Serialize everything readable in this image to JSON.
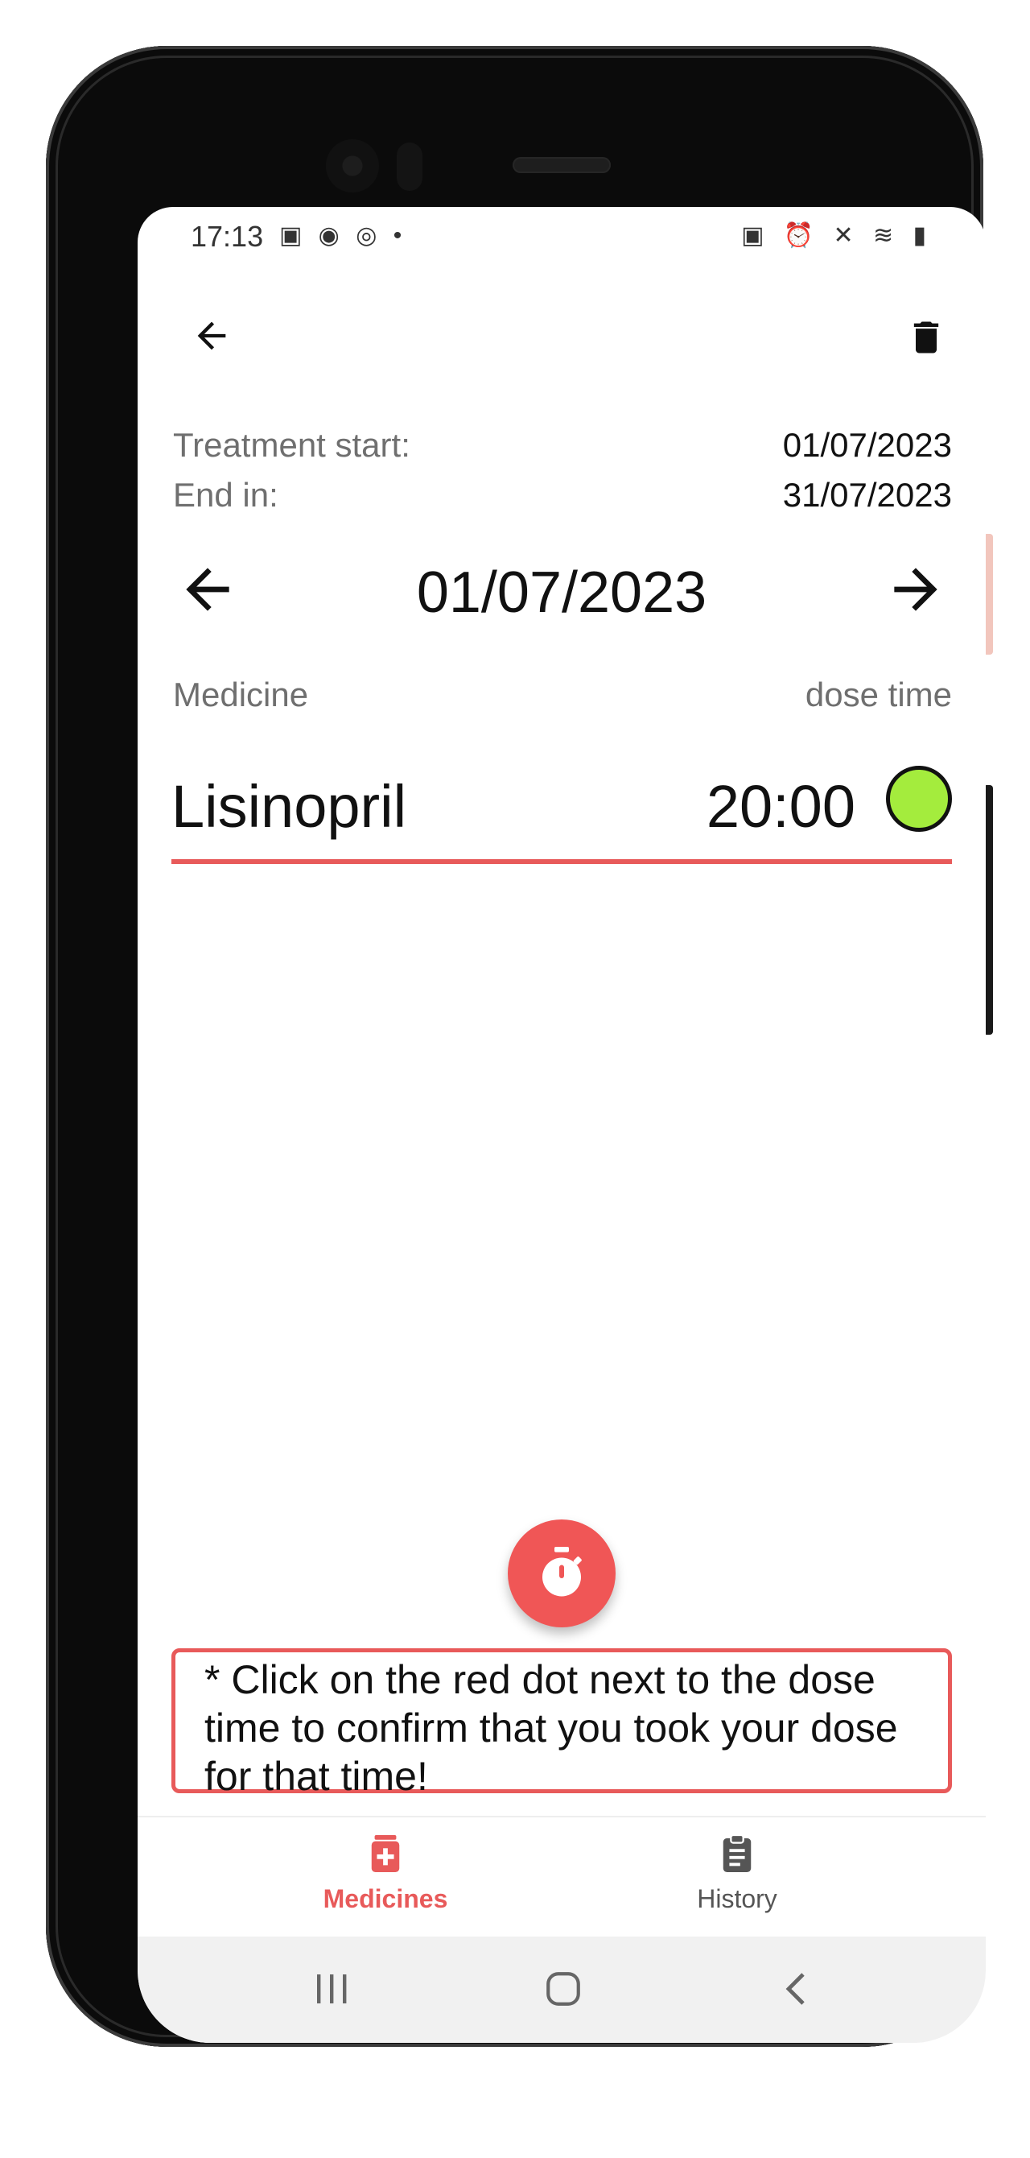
{
  "status_bar": {
    "time": "17:13",
    "left_icons": "▣ ◉ ◎ •",
    "right_icons": "▣ ⏰ ✕ ≋ ▮"
  },
  "app_bar": {
    "back_icon": "arrow-left-icon",
    "delete_icon": "trash-icon"
  },
  "treatment": {
    "start_label": "Treatment start:",
    "start_value": "01/07/2023",
    "end_label": "End in:",
    "end_value": "31/07/2023"
  },
  "date_nav": {
    "current_date": "01/07/2023"
  },
  "columns": {
    "medicine": "Medicine",
    "dose_time": "dose time"
  },
  "doses": [
    {
      "medicine": "Lisinopril",
      "time": "20:00",
      "status_color": "#a4ec3d"
    }
  ],
  "note": "* Click on the red dot next to the dose time to confirm that you took your dose for that time!",
  "bottom_nav": {
    "items": [
      {
        "label": "Medicines",
        "icon": "medicine-icon",
        "active": true
      },
      {
        "label": "History",
        "icon": "clipboard-icon",
        "active": false
      }
    ]
  },
  "colors": {
    "accent": "#e85a5a",
    "fab": "#f05656",
    "taken": "#a4ec3d"
  }
}
